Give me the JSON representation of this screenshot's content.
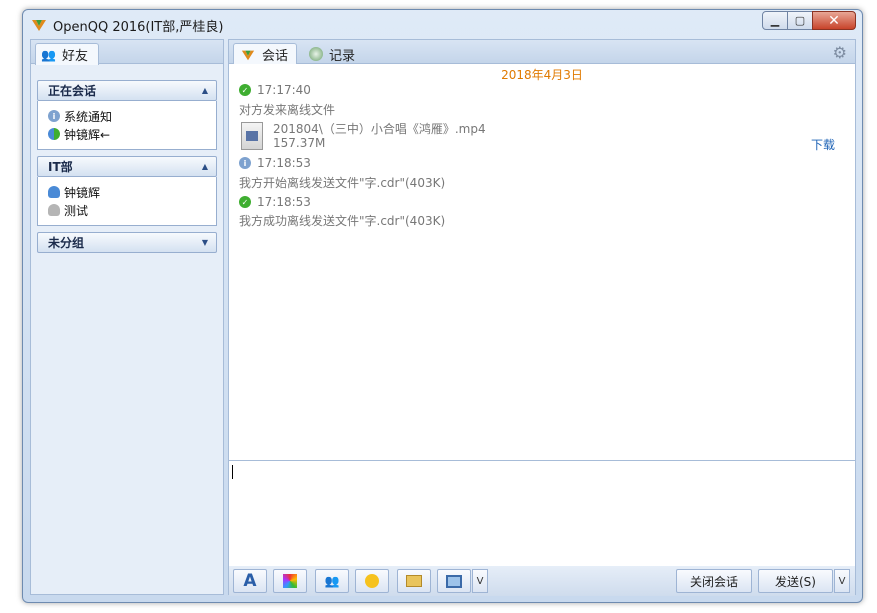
{
  "window": {
    "title": "OpenQQ 2016(IT部,严桂良)"
  },
  "left": {
    "tab": "好友",
    "groups": [
      {
        "name": "正在会话",
        "members": [
          "系统通知",
          "钟镜辉←"
        ]
      },
      {
        "name": "IT部",
        "members": [
          "钟镜辉",
          "测试"
        ]
      },
      {
        "name": "未分组",
        "members": []
      }
    ]
  },
  "right": {
    "tabs": [
      "会话",
      "记录"
    ],
    "date": "2018年4月3日",
    "messages": {
      "m1_time": "17:17:40",
      "m1_text": "对方发来离线文件",
      "file_name": "201804\\（三中）小合唱《鸿雁》.mp4",
      "file_size": "157.37M",
      "download": "下载",
      "m2_time": "17:18:53",
      "m2_text": "我方开始离线发送文件\"字.cdr\"(403K)",
      "m3_time": "17:18:53",
      "m3_text": "我方成功离线发送文件\"字.cdr\"(403K)"
    },
    "toolbar": {
      "font": "A",
      "close_label": "关闭会话",
      "send_label": "发送(S)",
      "dropdown": "V"
    }
  },
  "colors": {
    "accent": "#e07a00",
    "link": "#1e63b6",
    "ok": "#3fae31"
  }
}
